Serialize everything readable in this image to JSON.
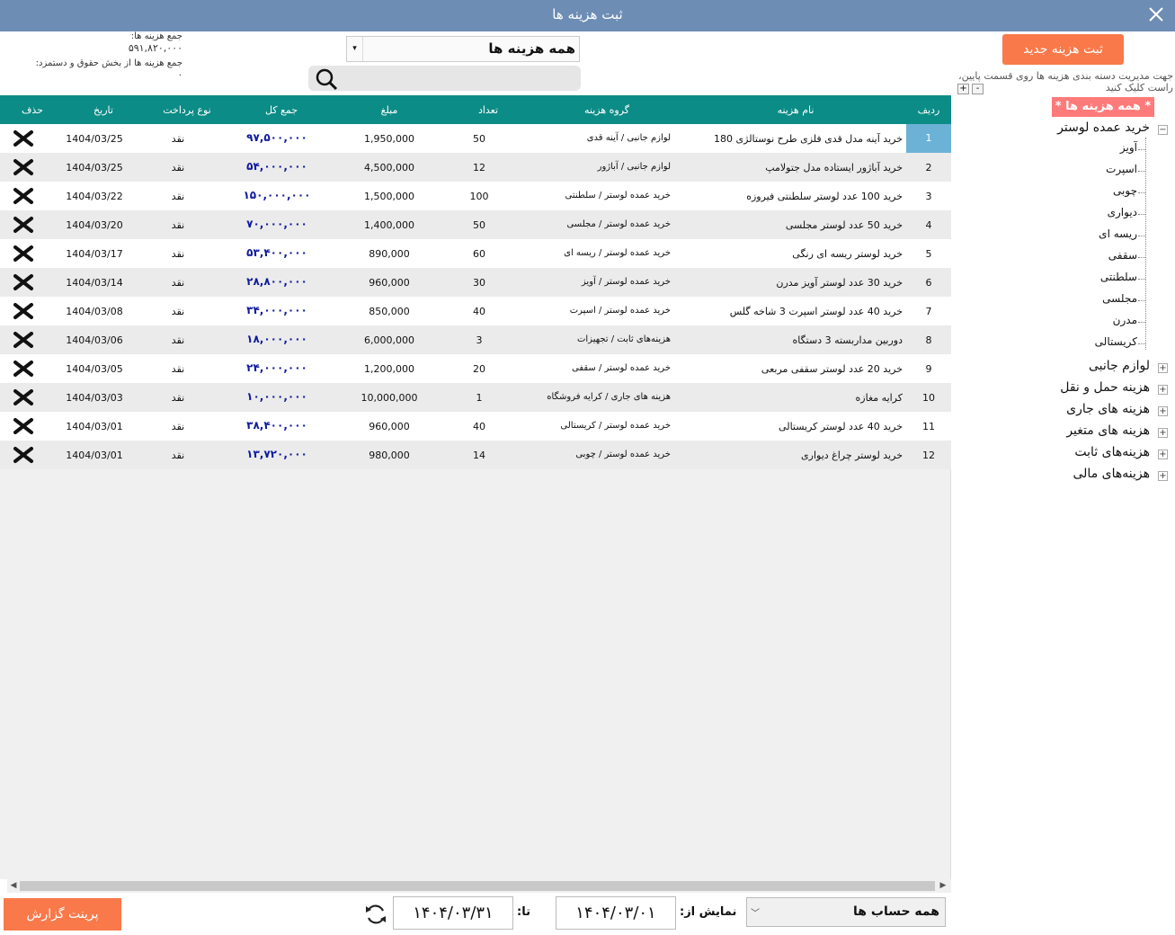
{
  "window": {
    "title": "ثبت هزینه ها"
  },
  "summary": {
    "total_label": "جمع هزینه ها:",
    "total_value": "۵۹۱,۸۲۰,۰۰۰",
    "salary_label": "جمع هزینه ها از بخش حقوق و دستمزد:",
    "salary_value": "۰"
  },
  "filter": {
    "selected": "همه هزینه ها"
  },
  "search": {
    "placeholder": "",
    "value": ""
  },
  "grid": {
    "headers": {
      "idx": "ردیف",
      "name": "نام هزینه",
      "group": "گروه هزینه",
      "qty": "تعداد",
      "price": "مبلغ",
      "total": "جمع کل",
      "pay": "نوع پرداخت",
      "date": "تاریخ",
      "del": "حذف"
    },
    "rows": [
      {
        "idx": "1",
        "name": "خرید آینه مدل قدی فلزی طرح نوستالژی 180",
        "group": "لوازم جانبی / آینه قدی",
        "qty": "50",
        "price": "1,950,000",
        "total": "۹۷,۵۰۰,۰۰۰",
        "pay": "نقد",
        "date": "1404/03/25"
      },
      {
        "idx": "2",
        "name": "خرید آباژور ایستاده مدل جتولامپ",
        "group": "لوازم جانبی / آباژور",
        "qty": "12",
        "price": "4,500,000",
        "total": "۵۴,۰۰۰,۰۰۰",
        "pay": "نقد",
        "date": "1404/03/25"
      },
      {
        "idx": "3",
        "name": "خرید 100 عدد لوستر سلطنتی فیروزه",
        "group": "خرید عمده لوستر / سلطنتی",
        "qty": "100",
        "price": "1,500,000",
        "total": "۱۵۰,۰۰۰,۰۰۰",
        "pay": "نقد",
        "date": "1404/03/22"
      },
      {
        "idx": "4",
        "name": "خرید 50 عدد لوستر مجلسی",
        "group": "خرید عمده لوستر / مجلسی",
        "qty": "50",
        "price": "1,400,000",
        "total": "۷۰,۰۰۰,۰۰۰",
        "pay": "نقد",
        "date": "1404/03/20"
      },
      {
        "idx": "5",
        "name": "خرید لوستر ریسه ای رنگی",
        "group": "خرید عمده لوستر / ریسه ای",
        "qty": "60",
        "price": "890,000",
        "total": "۵۳,۴۰۰,۰۰۰",
        "pay": "نقد",
        "date": "1404/03/17"
      },
      {
        "idx": "6",
        "name": "خرید 30 عدد لوستر آویز مدرن",
        "group": "خرید عمده لوستر / آویز",
        "qty": "30",
        "price": "960,000",
        "total": "۲۸,۸۰۰,۰۰۰",
        "pay": "نقد",
        "date": "1404/03/14"
      },
      {
        "idx": "7",
        "name": "خرید 40 عدد لوستر اسپرت 3 شاخه گلس",
        "group": "خرید عمده لوستر / اسپرت",
        "qty": "40",
        "price": "850,000",
        "total": "۳۴,۰۰۰,۰۰۰",
        "pay": "نقد",
        "date": "1404/03/08"
      },
      {
        "idx": "8",
        "name": "دوربین مداربسته 3 دستگاه",
        "group": "هزینه‌های ثابت / تجهیزات",
        "qty": "3",
        "price": "6,000,000",
        "total": "۱۸,۰۰۰,۰۰۰",
        "pay": "نقد",
        "date": "1404/03/06"
      },
      {
        "idx": "9",
        "name": "خرید 20 عدد لوستر سقفی مربعی",
        "group": "خرید عمده لوستر / سقفی",
        "qty": "20",
        "price": "1,200,000",
        "total": "۲۴,۰۰۰,۰۰۰",
        "pay": "نقد",
        "date": "1404/03/05"
      },
      {
        "idx": "10",
        "name": "کرایه مغازه",
        "group": "هزینه های جاری / کرایه فروشگاه",
        "qty": "1",
        "price": "10,000,000",
        "total": "۱۰,۰۰۰,۰۰۰",
        "pay": "نقد",
        "date": "1404/03/03"
      },
      {
        "idx": "11",
        "name": "خرید 40 عدد لوستر کریستالی",
        "group": "خرید عمده لوستر / کریستالی",
        "qty": "40",
        "price": "960,000",
        "total": "۳۸,۴۰۰,۰۰۰",
        "pay": "نقد",
        "date": "1404/03/01"
      },
      {
        "idx": "12",
        "name": "خرید لوستر چراغ دیواری",
        "group": "خرید عمده لوستر / چوبی",
        "qty": "14",
        "price": "980,000",
        "total": "۱۳,۷۲۰,۰۰۰",
        "pay": "نقد",
        "date": "1404/03/01"
      }
    ]
  },
  "sidebar": {
    "new_button": "ثبت هزینه جدید",
    "hint": "جهت مدیریت دسته بندی هزینه ها روی قسمت پایین، راست کلیک کنید",
    "plus": "+",
    "minus": "-",
    "tree_all": "* همه هزینه ها *",
    "tree_main": "خرید عمده لوستر",
    "tree_children": [
      "آویز",
      "اسپرت",
      "چوبی",
      "دیواری",
      "ریسه ای",
      "سقفی",
      "سلطنتی",
      "مجلسی",
      "مدرن",
      "کریستالی"
    ],
    "tree_others": [
      "لوازم جانبی",
      "هزینه حمل و نقل",
      "هزینه های جاری",
      "هزینه های متغیر",
      "هزینه‌های ثابت",
      "هزینه‌های مالی"
    ]
  },
  "footer": {
    "print_button": "پرینت گزارش",
    "to_label": "تا:",
    "to_date": "۱۴۰۴/۰۳/۳۱",
    "from_label": "نمایش از:",
    "from_date": "۱۴۰۴/۰۳/۰۱",
    "account_select": "همه حساب ها"
  },
  "colors": {
    "titlebar": "#6d8db5",
    "grid_header": "#0c8c86",
    "accent_button": "#f9794a",
    "tree_all": "#ff7a7a",
    "total_text": "#0f1a9c",
    "selected_index": "#6cb2d6"
  }
}
